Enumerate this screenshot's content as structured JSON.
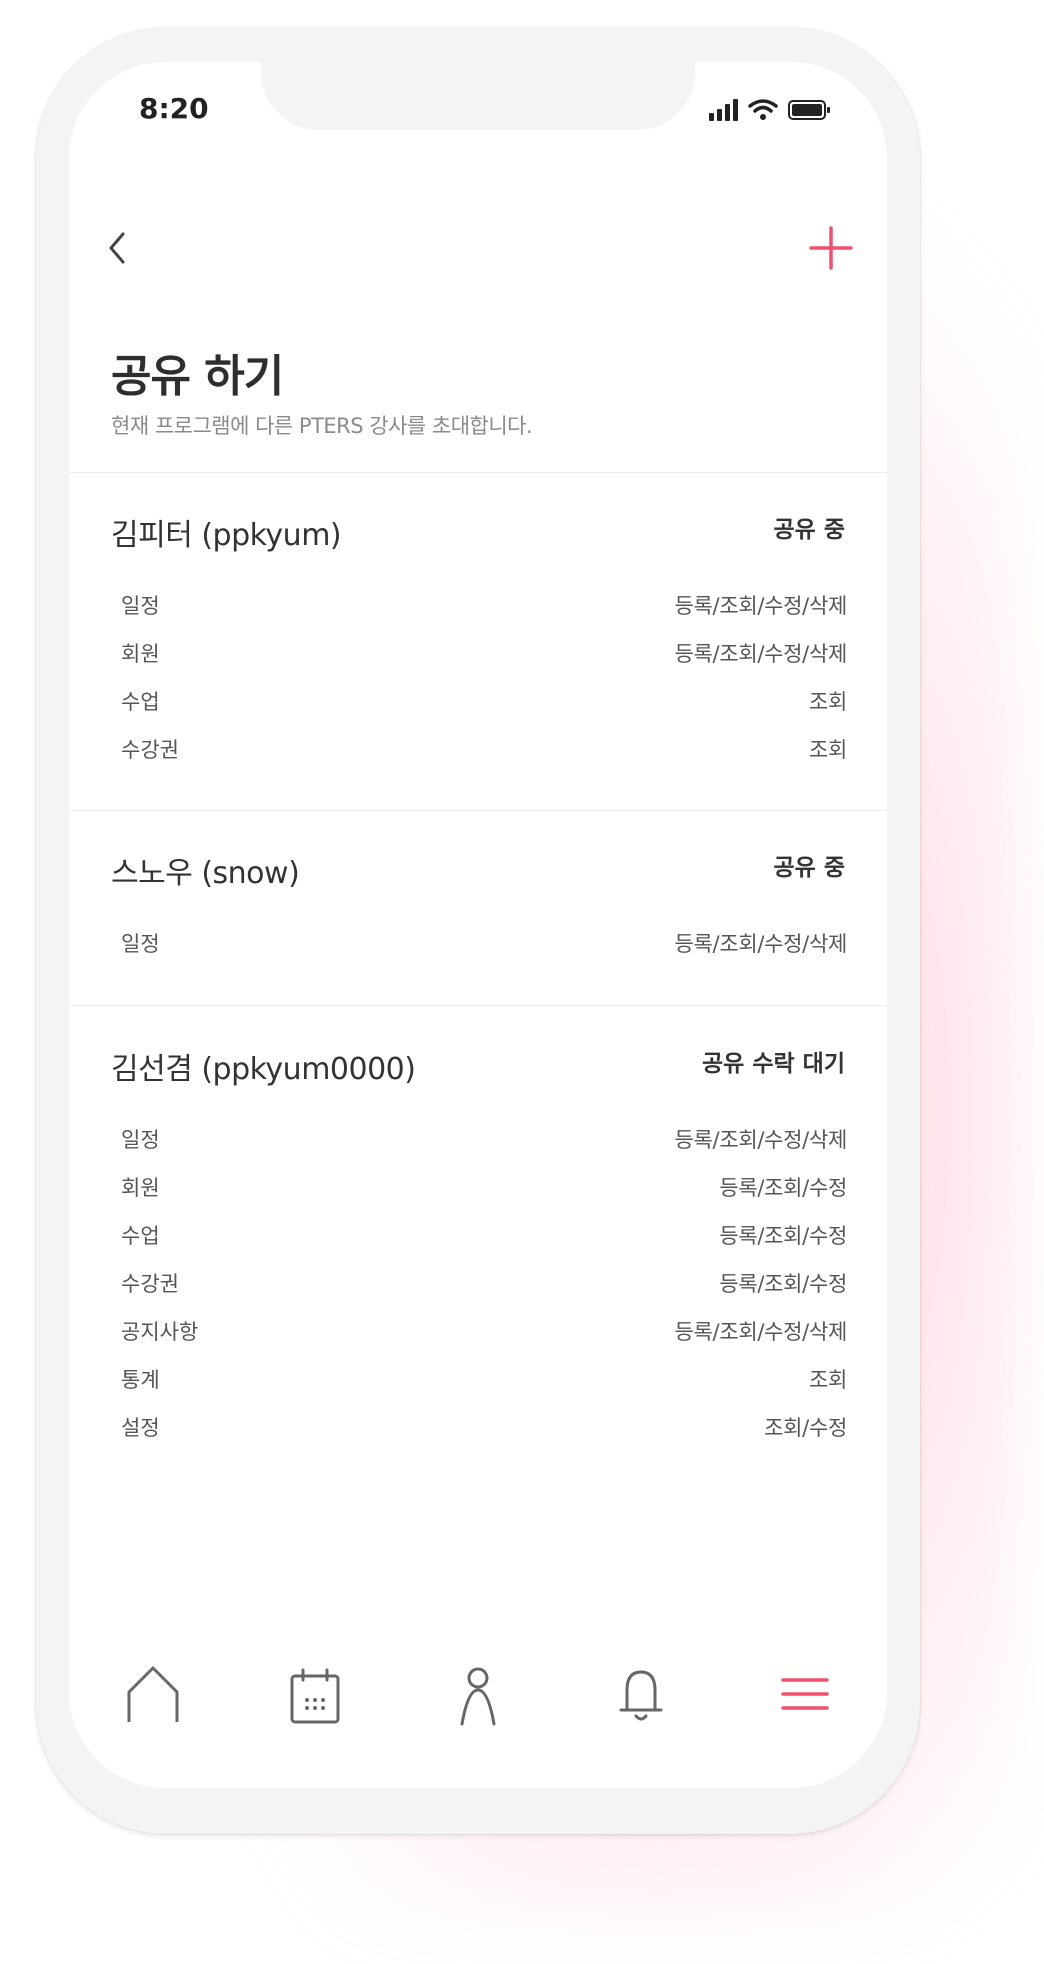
{
  "status_bar": {
    "time": "8:20"
  },
  "header": {
    "back_icon": "chevron-left-icon",
    "add_icon": "plus-icon",
    "title": "공유 하기",
    "subtitle": "현재 프로그램에 다른 PTERS 강사를 초대합니다."
  },
  "colors": {
    "accent": "#f0516e",
    "text": "#333333",
    "muted": "#8a8a8a"
  },
  "shares": [
    {
      "name": "김피터 (ppkyum)",
      "status": "공유 중",
      "permissions": [
        {
          "label": "일정",
          "value": "등록/조회/수정/삭제"
        },
        {
          "label": "회원",
          "value": "등록/조회/수정/삭제"
        },
        {
          "label": "수업",
          "value": "조회"
        },
        {
          "label": "수강권",
          "value": "조회"
        }
      ]
    },
    {
      "name": "스노우 (snow)",
      "status": "공유 중",
      "permissions": [
        {
          "label": "일정",
          "value": "등록/조회/수정/삭제"
        }
      ]
    },
    {
      "name": "김선겸 (ppkyum0000)",
      "status": "공유 수락 대기",
      "permissions": [
        {
          "label": "일정",
          "value": "등록/조회/수정/삭제"
        },
        {
          "label": "회원",
          "value": "등록/조회/수정"
        },
        {
          "label": "수업",
          "value": "등록/조회/수정"
        },
        {
          "label": "수강권",
          "value": "등록/조회/수정"
        },
        {
          "label": "공지사항",
          "value": "등록/조회/수정/삭제"
        },
        {
          "label": "통계",
          "value": "조회"
        },
        {
          "label": "설정",
          "value": "조회/수정"
        }
      ]
    }
  ],
  "tabbar": {
    "items": [
      {
        "icon": "home-icon"
      },
      {
        "icon": "calendar-icon"
      },
      {
        "icon": "person-icon"
      },
      {
        "icon": "bell-icon"
      },
      {
        "icon": "menu-icon",
        "active": true
      }
    ]
  }
}
